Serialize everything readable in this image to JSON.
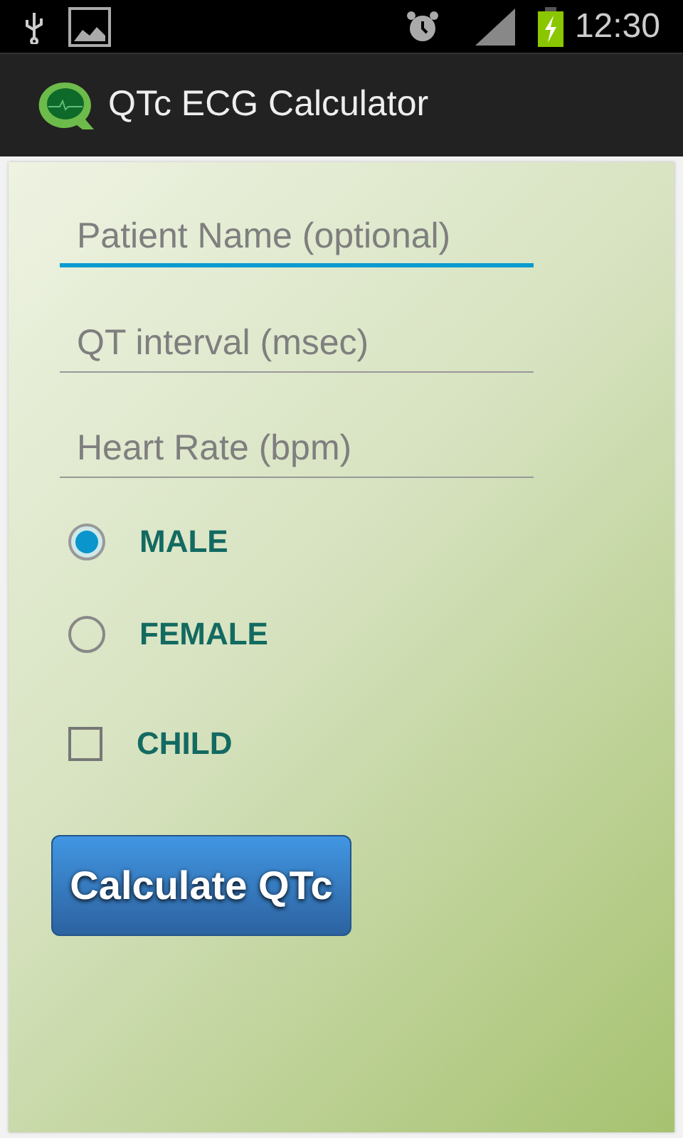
{
  "status_bar": {
    "time": "12:30"
  },
  "action_bar": {
    "title": "QTc ECG Calculator"
  },
  "fields": [
    {
      "placeholder": "Patient Name (optional)",
      "focused": true
    },
    {
      "placeholder": "QT interval (msec)",
      "focused": false
    },
    {
      "placeholder": "Heart Rate (bpm)",
      "focused": false
    }
  ],
  "sex_options": [
    {
      "label": "MALE",
      "selected": true
    },
    {
      "label": "FEMALE",
      "selected": false
    }
  ],
  "child": {
    "label": "CHILD",
    "checked": false
  },
  "button": {
    "label": "Calculate QTc"
  }
}
